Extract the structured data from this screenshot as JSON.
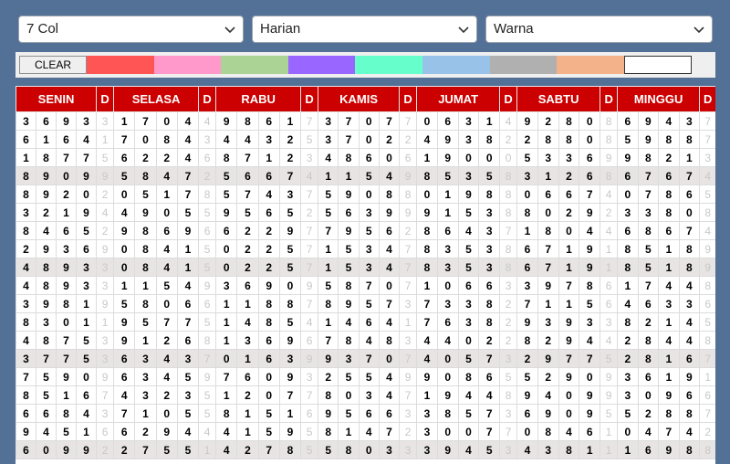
{
  "selects": {
    "columns": "7 Col",
    "mode": "Harian",
    "color": "Warna"
  },
  "toolbar": {
    "clear_label": "CLEAR",
    "swatches": [
      "#ff5555",
      "#ff99cc",
      "#aad395",
      "#9966ff",
      "#66ffcc",
      "#99c2e8",
      "#b0b0b0",
      "#f4b28a",
      "#ffffff"
    ]
  },
  "colors": {
    "background": "#537097",
    "header_red": "#cc0000",
    "alt_row": "#e8e4e4"
  },
  "table": {
    "headers": [
      "SENIN",
      "D",
      "SELASA",
      "D",
      "RABU",
      "D",
      "KAMIS",
      "D",
      "JUMAT",
      "D",
      "SABTU",
      "D",
      "MINGGU",
      "D"
    ],
    "rows": [
      {
        "alt": false,
        "cells": [
          "3693",
          "3",
          "1704",
          "4",
          "9861",
          "7",
          "3707",
          "7",
          "0631",
          "4",
          "9280",
          "8",
          "6943",
          "7"
        ]
      },
      {
        "alt": false,
        "cells": [
          "6164",
          "1",
          "7084",
          "3",
          "4432",
          "5",
          "3702",
          "2",
          "4938",
          "2",
          "2880",
          "8",
          "5988",
          "7"
        ]
      },
      {
        "alt": false,
        "cells": [
          "1877",
          "5",
          "6224",
          "6",
          "8712",
          "3",
          "4860",
          "6",
          "1900",
          "0",
          "5336",
          "9",
          "9821",
          "3"
        ]
      },
      {
        "alt": true,
        "cells": [
          "8909",
          "9",
          "5847",
          "2",
          "5667",
          "4",
          "1154",
          "9",
          "8535",
          "8",
          "3126",
          "8",
          "6767",
          "4"
        ]
      },
      {
        "alt": false,
        "cells": [
          "8920",
          "2",
          "0517",
          "8",
          "5743",
          "7",
          "5908",
          "8",
          "0198",
          "8",
          "0667",
          "4",
          "0786",
          "5"
        ]
      },
      {
        "alt": false,
        "cells": [
          "3219",
          "4",
          "4905",
          "5",
          "9565",
          "2",
          "5639",
          "9",
          "9153",
          "8",
          "8029",
          "2",
          "3380",
          "8"
        ]
      },
      {
        "alt": false,
        "cells": [
          "8465",
          "2",
          "9869",
          "6",
          "6229",
          "7",
          "7956",
          "2",
          "8643",
          "7",
          "1804",
          "4",
          "6867",
          "4"
        ]
      },
      {
        "alt": false,
        "cells": [
          "2936",
          "9",
          "0841",
          "5",
          "0225",
          "7",
          "1534",
          "7",
          "8353",
          "8",
          "6719",
          "1",
          "8518",
          "9"
        ]
      },
      {
        "alt": true,
        "cells": [
          "4893",
          "3",
          "0841",
          "5",
          "0225",
          "7",
          "1534",
          "7",
          "8353",
          "8",
          "6719",
          "1",
          "8518",
          "9"
        ]
      },
      {
        "alt": false,
        "cells": [
          "4893",
          "3",
          "1154",
          "9",
          "3690",
          "9",
          "5870",
          "7",
          "1066",
          "3",
          "3978",
          "6",
          "1744",
          "8"
        ]
      },
      {
        "alt": false,
        "cells": [
          "3981",
          "9",
          "5806",
          "6",
          "1188",
          "7",
          "8957",
          "3",
          "7338",
          "2",
          "7115",
          "6",
          "4633",
          "6"
        ]
      },
      {
        "alt": false,
        "cells": [
          "8301",
          "1",
          "9577",
          "5",
          "1485",
          "4",
          "1464",
          "1",
          "7638",
          "2",
          "9393",
          "3",
          "8214",
          "5"
        ]
      },
      {
        "alt": false,
        "cells": [
          "4875",
          "3",
          "9126",
          "8",
          "1369",
          "6",
          "7848",
          "3",
          "4402",
          "2",
          "8294",
          "4",
          "2844",
          "8"
        ]
      },
      {
        "alt": true,
        "cells": [
          "3775",
          "3",
          "6343",
          "7",
          "0163",
          "9",
          "9370",
          "7",
          "4057",
          "3",
          "2977",
          "5",
          "2816",
          "7"
        ]
      },
      {
        "alt": false,
        "cells": [
          "7590",
          "9",
          "6345",
          "9",
          "7609",
          "3",
          "2554",
          "9",
          "9086",
          "5",
          "5290",
          "9",
          "3619",
          "1"
        ]
      },
      {
        "alt": false,
        "cells": [
          "8516",
          "7",
          "4323",
          "5",
          "1207",
          "7",
          "8034",
          "7",
          "1944",
          "8",
          "9409",
          "9",
          "3096",
          "6"
        ]
      },
      {
        "alt": false,
        "cells": [
          "6684",
          "3",
          "7105",
          "5",
          "8151",
          "6",
          "9566",
          "3",
          "3857",
          "3",
          "6909",
          "5",
          "5288",
          "7"
        ]
      },
      {
        "alt": false,
        "cells": [
          "9451",
          "6",
          "6294",
          "4",
          "4159",
          "5",
          "8147",
          "2",
          "3007",
          "7",
          "0846",
          "1",
          "0474",
          "2"
        ]
      },
      {
        "alt": true,
        "cells": [
          "6099",
          "2",
          "2755",
          "1",
          "4278",
          "5",
          "5803",
          "3",
          "3945",
          "3",
          "4381",
          "1",
          "1698",
          "8"
        ]
      }
    ]
  }
}
